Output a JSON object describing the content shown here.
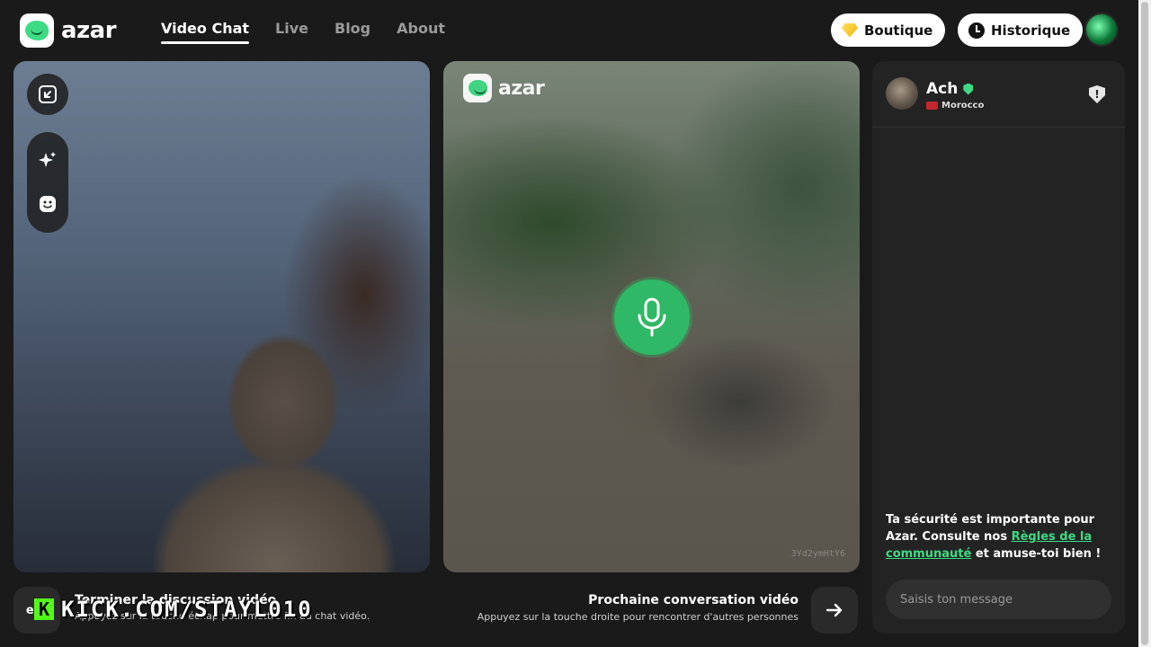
{
  "brand": {
    "name": "azar"
  },
  "nav": [
    {
      "label": "Video Chat",
      "active": true
    },
    {
      "label": "Live",
      "active": false
    },
    {
      "label": "Blog",
      "active": false
    },
    {
      "label": "About",
      "active": false
    }
  ],
  "header_buttons": {
    "boutique": "Boutique",
    "historique": "Historique"
  },
  "center": {
    "logo_text": "azar",
    "user_code": "3Yd2ymHtY6"
  },
  "chat": {
    "partner_name": "Ach",
    "partner_country": "Morocco",
    "report_glyph": "!",
    "safety_text_1": "Ta sécurité est importante pour Azar. Consulte nos ",
    "safety_link": "Règles de la communauté",
    "safety_text_2": " et amuse-toi bien !",
    "input_placeholder": "Saisis ton message"
  },
  "bottom": {
    "end_key": "esc",
    "end_title": "Terminer la discussion vidéo",
    "end_sub": "Appuyez sur la touche échap pour mettre fin au chat vidéo.",
    "next_title": "Prochaine conversation vidéo",
    "next_sub": "Appuyez sur la touche droite pour rencontrer d'autres personnes"
  },
  "overlay": {
    "kick_letter": "K",
    "kick_text": "KICK.COM/STAYL010"
  },
  "colors": {
    "accent": "#3ddc84",
    "mic": "#2fb865",
    "background": "#1a1a1b",
    "panel": "#232324"
  },
  "icons": [
    "diamond-icon",
    "clock-icon",
    "minimize-icon",
    "sparkle-icon",
    "smile-icon",
    "microphone-icon",
    "shield-alert-icon",
    "arrow-right-icon"
  ]
}
